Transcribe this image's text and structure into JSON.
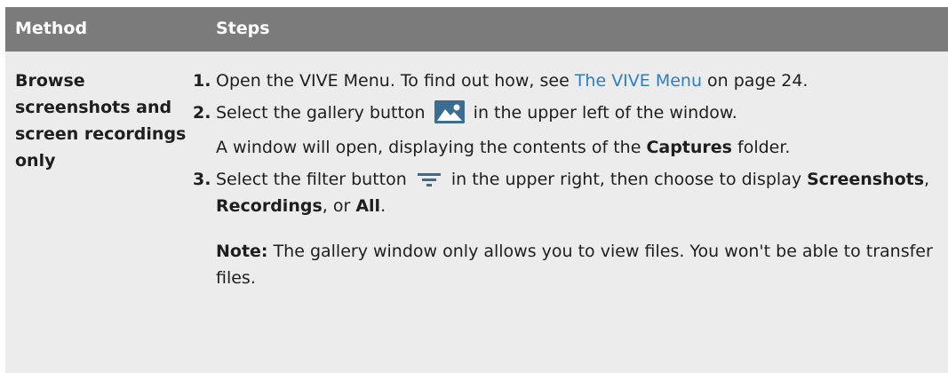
{
  "table": {
    "headers": {
      "method": "Method",
      "steps": "Steps"
    },
    "method": "Browse screenshots and screen recordings only",
    "steps": [
      {
        "num": "1.",
        "before_link": "Open the VIVE Menu. To find out how, see ",
        "link": "The VIVE Menu",
        "after_link": " on page 24."
      },
      {
        "num": "2.",
        "text_before_icon": "Select the gallery button",
        "icon": "gallery-icon",
        "text_after_icon": " in the upper left of the window.",
        "sub": {
          "before_bold": "A window will open, displaying the contents of the ",
          "bold": "Captures",
          "after_bold": " folder."
        }
      },
      {
        "num": "3.",
        "text_before_icon": "Select the filter button",
        "icon": "filter-icon",
        "text_after_icon": " in the upper right, then choose to display ",
        "options": [
          "Screenshots",
          "Recordings",
          "All"
        ],
        "sep1": ", ",
        "sep2": ", or ",
        "end": "."
      }
    ],
    "note": {
      "label": "Note:",
      "text": " The gallery window only allows you to view files. You won't be able to transfer files."
    }
  }
}
